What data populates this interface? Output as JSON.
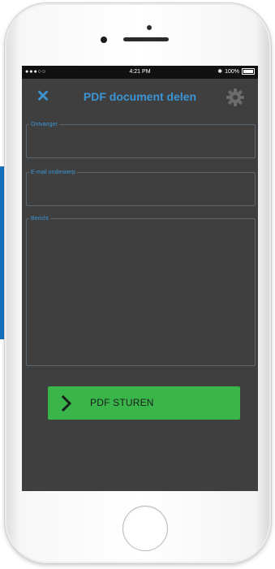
{
  "status_bar": {
    "signal": "●●●○○",
    "time": "4:21 PM",
    "bluetooth": "✱",
    "battery_text": "100%"
  },
  "nav": {
    "close_icon": "close-icon",
    "title": "PDF document delen",
    "settings_icon": "gear-icon",
    "accent_color": "#3b95d4"
  },
  "form": {
    "recipient_label": "Ontvanger",
    "recipient_value": "",
    "subject_label": "E-mail onderwerp",
    "subject_value": "",
    "message_label": "Bericht",
    "message_value": ""
  },
  "send_button": {
    "label": "PDF STUREN",
    "icon": "chevron-right-icon",
    "color": "#39b54a"
  }
}
